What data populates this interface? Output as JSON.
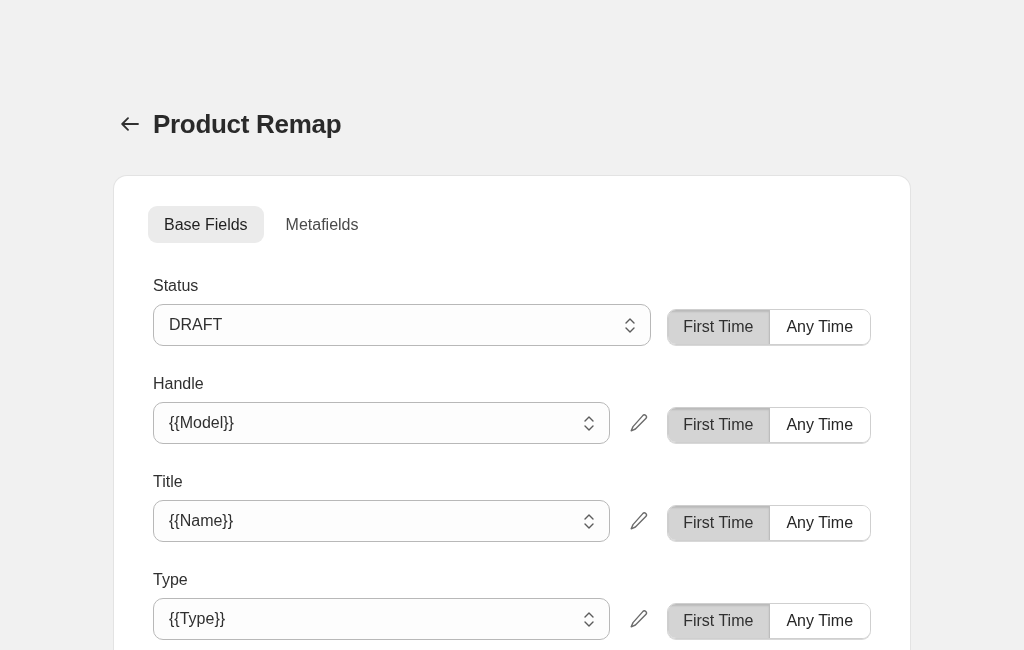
{
  "page": {
    "title": "Product Remap"
  },
  "tabs": [
    {
      "label": "Base Fields",
      "selected": true
    },
    {
      "label": "Metafields",
      "selected": false
    }
  ],
  "fields": [
    {
      "label": "Status",
      "value": "DRAFT",
      "editable": false,
      "options": [
        {
          "label": "First Time",
          "selected": true
        },
        {
          "label": "Any Time",
          "selected": false
        }
      ]
    },
    {
      "label": "Handle",
      "value": "{{Model}}",
      "editable": true,
      "options": [
        {
          "label": "First Time",
          "selected": true
        },
        {
          "label": "Any Time",
          "selected": false
        }
      ]
    },
    {
      "label": "Title",
      "value": "{{Name}}",
      "editable": true,
      "options": [
        {
          "label": "First Time",
          "selected": true
        },
        {
          "label": "Any Time",
          "selected": false
        }
      ]
    },
    {
      "label": "Type",
      "value": "{{Type}}",
      "editable": true,
      "options": [
        {
          "label": "First Time",
          "selected": true
        },
        {
          "label": "Any Time",
          "selected": false
        }
      ]
    }
  ]
}
